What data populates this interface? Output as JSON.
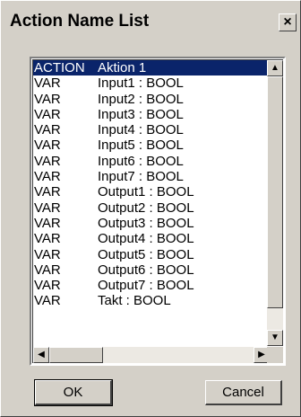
{
  "window": {
    "title": "Action Name List",
    "close_label": "×"
  },
  "list": {
    "items": [
      {
        "kind": "ACTION",
        "value": "Aktion 1",
        "selected": true
      },
      {
        "kind": "VAR",
        "value": "Input1 : BOOL"
      },
      {
        "kind": "VAR",
        "value": "Input2 : BOOL"
      },
      {
        "kind": "VAR",
        "value": "Input3 : BOOL"
      },
      {
        "kind": "VAR",
        "value": "Input4 : BOOL"
      },
      {
        "kind": "VAR",
        "value": "Input5 : BOOL"
      },
      {
        "kind": "VAR",
        "value": "Input6 : BOOL"
      },
      {
        "kind": "VAR",
        "value": "Input7 : BOOL"
      },
      {
        "kind": "VAR",
        "value": "Output1 : BOOL"
      },
      {
        "kind": "VAR",
        "value": "Output2 : BOOL"
      },
      {
        "kind": "VAR",
        "value": "Output3 : BOOL"
      },
      {
        "kind": "VAR",
        "value": "Output4 : BOOL"
      },
      {
        "kind": "VAR",
        "value": "Output5 : BOOL"
      },
      {
        "kind": "VAR",
        "value": "Output6 : BOOL"
      },
      {
        "kind": "VAR",
        "value": "Output7 : BOOL"
      },
      {
        "kind": "VAR",
        "value": "Takt : BOOL"
      }
    ]
  },
  "scrollbars": {
    "up_glyph": "▲",
    "down_glyph": "▼",
    "left_glyph": "◀",
    "right_glyph": "▶"
  },
  "buttons": {
    "ok_label": "OK",
    "cancel_label": "Cancel"
  },
  "colors": {
    "selection": "#0a246a",
    "face": "#d4d0c8"
  }
}
